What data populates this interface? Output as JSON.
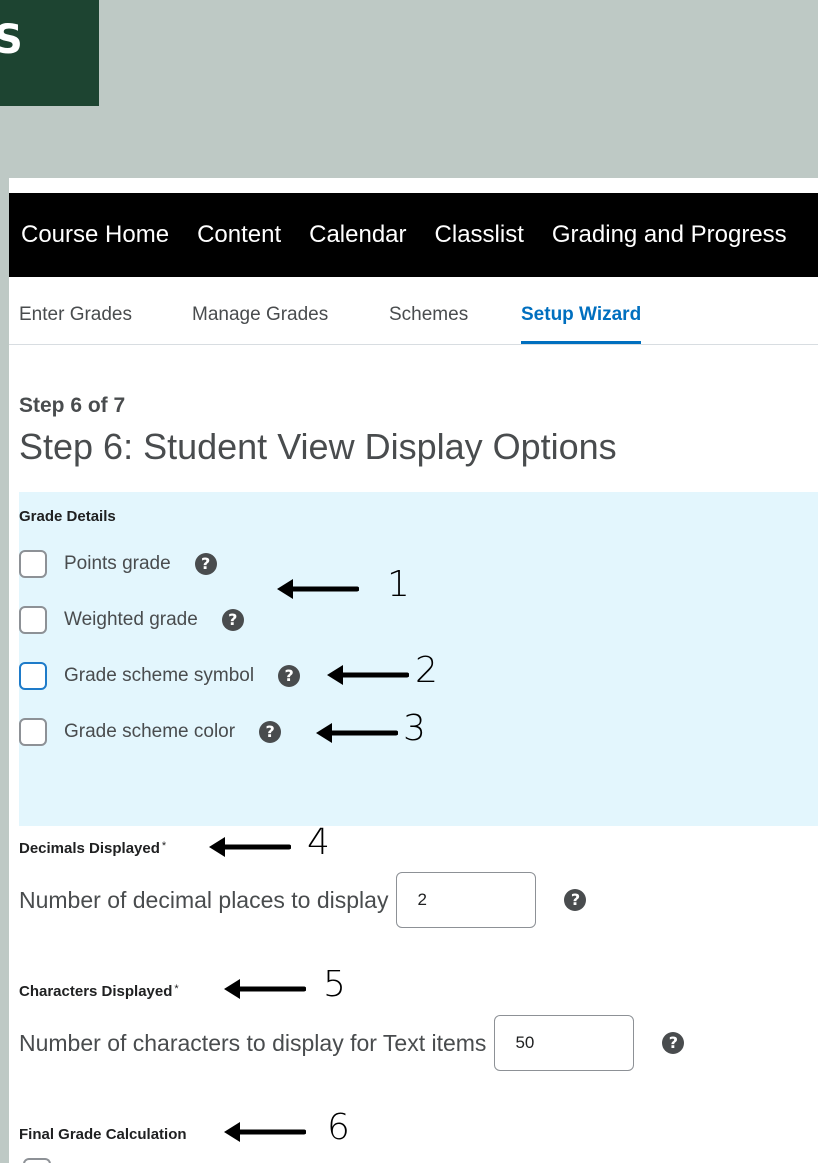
{
  "tag_text": "S",
  "nav": {
    "items": [
      "Course Home",
      "Content",
      "Calendar",
      "Classlist",
      "Grading and Progress"
    ]
  },
  "subnav": {
    "tabs": [
      "Enter Grades",
      "Manage Grades",
      "Schemes",
      "Setup Wizard"
    ],
    "active": "Setup Wizard"
  },
  "step": {
    "label": "Step 6 of 7",
    "title": "Step 6: Student View Display Options"
  },
  "grade_details": {
    "label": "Grade Details",
    "options": [
      {
        "label": "Points grade",
        "checked": false
      },
      {
        "label": "Weighted grade",
        "checked": false
      },
      {
        "label": "Grade scheme symbol",
        "checked": false
      },
      {
        "label": "Grade scheme color",
        "checked": false
      }
    ]
  },
  "decimals": {
    "label": "Decimals Displayed",
    "required_mark": "*",
    "prompt": "Number of decimal places to display",
    "value": "2"
  },
  "characters": {
    "label": "Characters Displayed",
    "required_mark": "*",
    "prompt": "Number of characters to display for Text items",
    "value": "50"
  },
  "final_grade": {
    "label": "Final Grade Calculation"
  },
  "help_glyph": "?",
  "annotations": [
    "1",
    "2",
    "3",
    "4",
    "5",
    "6"
  ]
}
